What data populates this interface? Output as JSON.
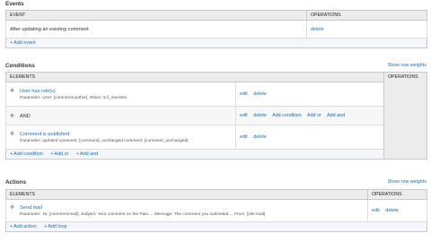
{
  "events": {
    "heading": "Events",
    "col_event": "EVENT",
    "col_ops": "OPERATIONS",
    "row_label": "After updating an existing comment",
    "row_delete": "delete",
    "add": "Add event"
  },
  "conditions": {
    "heading": "Conditions",
    "show_weights": "Show row weights",
    "col_elements": "ELEMENTS",
    "col_ops": "OPERATIONS",
    "items": [
      {
        "title": "User has role(s)",
        "param_prefix": "Parameter:",
        "p1_key": "User:",
        "p1_val": "[comment:author],",
        "p2_key": "Roles:",
        "p2_val": "scf_member",
        "edit": "edit",
        "delete": "delete"
      },
      {
        "title": "AND",
        "edit": "edit",
        "delete": "delete",
        "add_condition": "Add condition",
        "add_or": "Add or",
        "add_and": "Add and"
      },
      {
        "title": "Comment is published",
        "param_prefix": "Parameter:",
        "p1_key": "updated comment:",
        "p1_val": "[comment],",
        "p2_key": "unchanged comment:",
        "p2_val": "[comment_unchanged]",
        "edit": "edit",
        "delete": "delete"
      }
    ],
    "add_condition": "Add condition",
    "add_or": "Add or",
    "add_and": "Add and"
  },
  "actions": {
    "heading": "Actions",
    "show_weights": "Show row weights",
    "col_elements": "ELEMENTS",
    "col_ops": "OPERATIONS",
    "item": {
      "title": "Send mail",
      "param_prefix": "Parameter:",
      "p1_key": "To:",
      "p1_val": "[comment:mail],",
      "p2_key": "Subject:",
      "p2_val": "Your comment on the Pain...,",
      "p3_key": "Message:",
      "p3_val": "The comment you submitted...,",
      "p4_key": "From:",
      "p4_val": "[site:mail]",
      "edit": "edit",
      "delete": "delete"
    },
    "add_action": "Add action",
    "add_loop": "Add loop"
  }
}
